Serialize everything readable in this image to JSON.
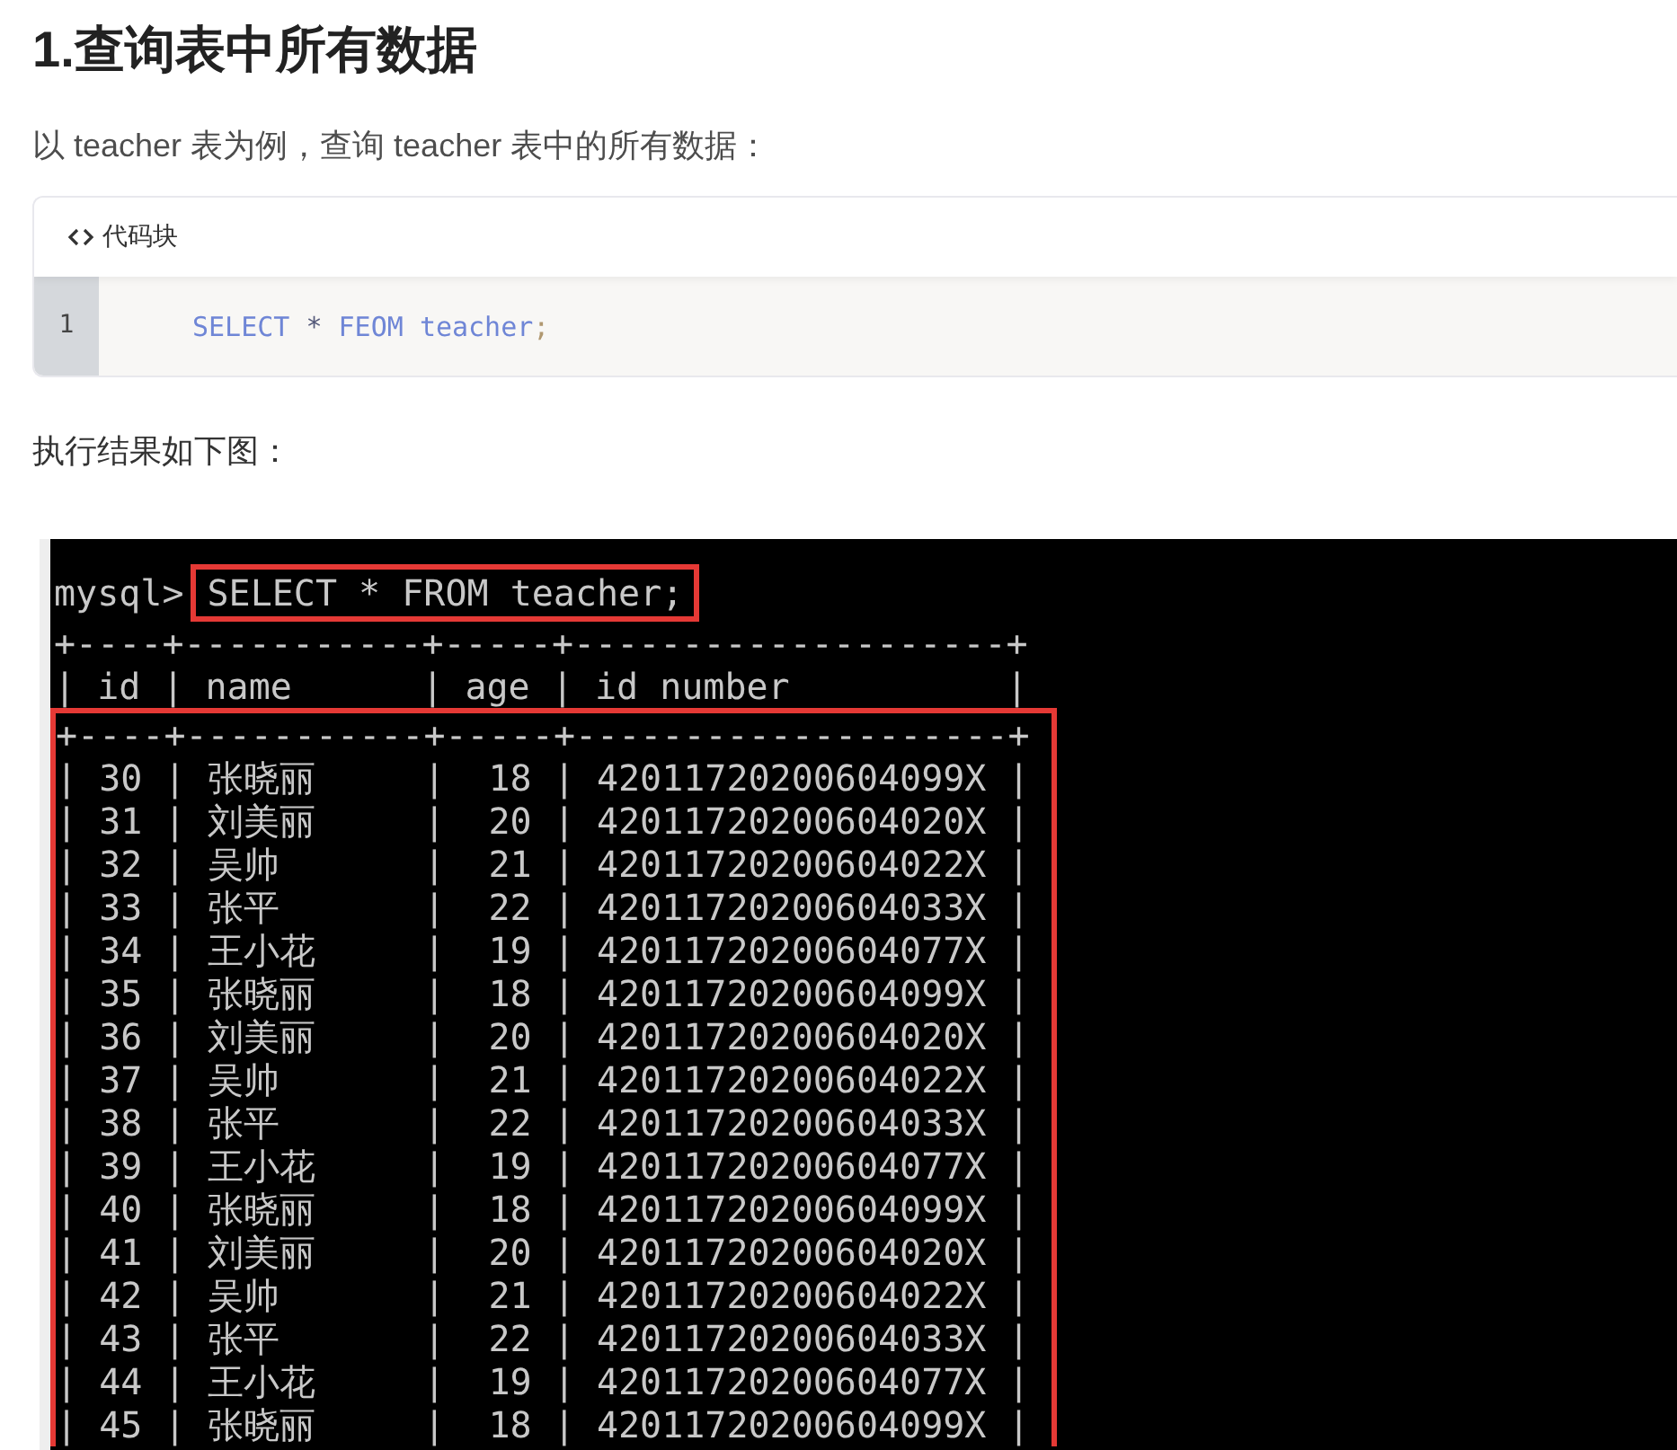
{
  "heading": "1.查询表中所有数据",
  "intro": "以 teacher 表为例，查询 teacher 表中的所有数据：",
  "code_block": {
    "label": "代码块",
    "lines": [
      {
        "number": "1",
        "tokens": [
          {
            "kind": "keyword",
            "text": "SELECT"
          },
          {
            "kind": "operator",
            "text": "*"
          },
          {
            "kind": "keyword",
            "text": "FEOM"
          },
          {
            "kind": "keyword",
            "text": "teacher"
          },
          {
            "kind": "punct",
            "text": ";"
          }
        ]
      }
    ]
  },
  "result_label": "执行结果如下图：",
  "terminal": {
    "prompt": "mysql>",
    "command": "SELECT * FROM teacher;",
    "border": "+----+-----------+-----+--------------------+",
    "separator": "|",
    "columns": [
      "id",
      "name",
      "age",
      "id number"
    ],
    "rows": [
      {
        "id": "30",
        "name": "张晓丽",
        "age": "18",
        "id_number": "42011720200604099X"
      },
      {
        "id": "31",
        "name": "刘美丽",
        "age": "20",
        "id_number": "42011720200604020X"
      },
      {
        "id": "32",
        "name": "吴帅",
        "age": "21",
        "id_number": "42011720200604022X"
      },
      {
        "id": "33",
        "name": "张平",
        "age": "22",
        "id_number": "42011720200604033X"
      },
      {
        "id": "34",
        "name": "王小花",
        "age": "19",
        "id_number": "42011720200604077X"
      },
      {
        "id": "35",
        "name": "张晓丽",
        "age": "18",
        "id_number": "42011720200604099X"
      },
      {
        "id": "36",
        "name": "刘美丽",
        "age": "20",
        "id_number": "42011720200604020X"
      },
      {
        "id": "37",
        "name": "吴帅",
        "age": "21",
        "id_number": "42011720200604022X"
      },
      {
        "id": "38",
        "name": "张平",
        "age": "22",
        "id_number": "42011720200604033X"
      },
      {
        "id": "39",
        "name": "王小花",
        "age": "19",
        "id_number": "42011720200604077X"
      },
      {
        "id": "40",
        "name": "张晓丽",
        "age": "18",
        "id_number": "42011720200604099X"
      },
      {
        "id": "41",
        "name": "刘美丽",
        "age": "20",
        "id_number": "42011720200604020X"
      },
      {
        "id": "42",
        "name": "吴帅",
        "age": "21",
        "id_number": "42011720200604022X"
      },
      {
        "id": "43",
        "name": "张平",
        "age": "22",
        "id_number": "42011720200604033X"
      },
      {
        "id": "44",
        "name": "王小花",
        "age": "19",
        "id_number": "42011720200604077X"
      },
      {
        "id": "45",
        "name": "张晓丽",
        "age": "18",
        "id_number": "42011720200604099X"
      }
    ]
  }
}
